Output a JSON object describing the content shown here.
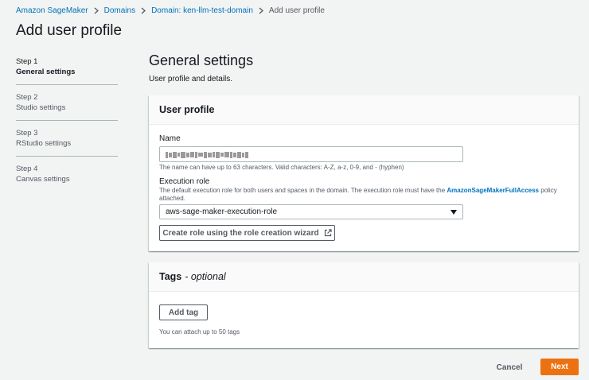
{
  "breadcrumb": {
    "items": [
      "Amazon SageMaker",
      "Domains",
      "Domain: ken-llm-test-domain"
    ],
    "current": "Add user profile"
  },
  "page": {
    "title": "Add user profile"
  },
  "steps": [
    {
      "num": "Step 1",
      "label": "General settings",
      "active": true
    },
    {
      "num": "Step 2",
      "label": "Studio settings",
      "active": false
    },
    {
      "num": "Step 3",
      "label": "RStudio settings",
      "active": false
    },
    {
      "num": "Step 4",
      "label": "Canvas settings",
      "active": false
    }
  ],
  "general": {
    "title": "General settings",
    "description": "User profile and details."
  },
  "user_profile": {
    "header": "User profile",
    "name_label": "Name",
    "name_hint": "The name can have up to 63 characters. Valid characters: A-Z, a-z, 0-9, and - (hyphen)",
    "role_label": "Execution role",
    "role_desc_prefix": "The default execution role for both users and spaces in the domain. The execution role must have the ",
    "role_desc_link": "AmazonSageMakerFullAccess",
    "role_desc_suffix": " policy attached.",
    "role_value": "aws-sage-maker-execution-role",
    "create_role_button": "Create role using the role creation wizard"
  },
  "tags": {
    "header": "Tags",
    "optional": "- optional",
    "add_tag_button": "Add tag",
    "hint": "You can attach up to 50 tags"
  },
  "footer": {
    "cancel_label": "Cancel",
    "next_label": "Next"
  },
  "colors": {
    "link": "#0073bb",
    "primary_button": "#ec7211",
    "background": "#f2f3f3"
  }
}
